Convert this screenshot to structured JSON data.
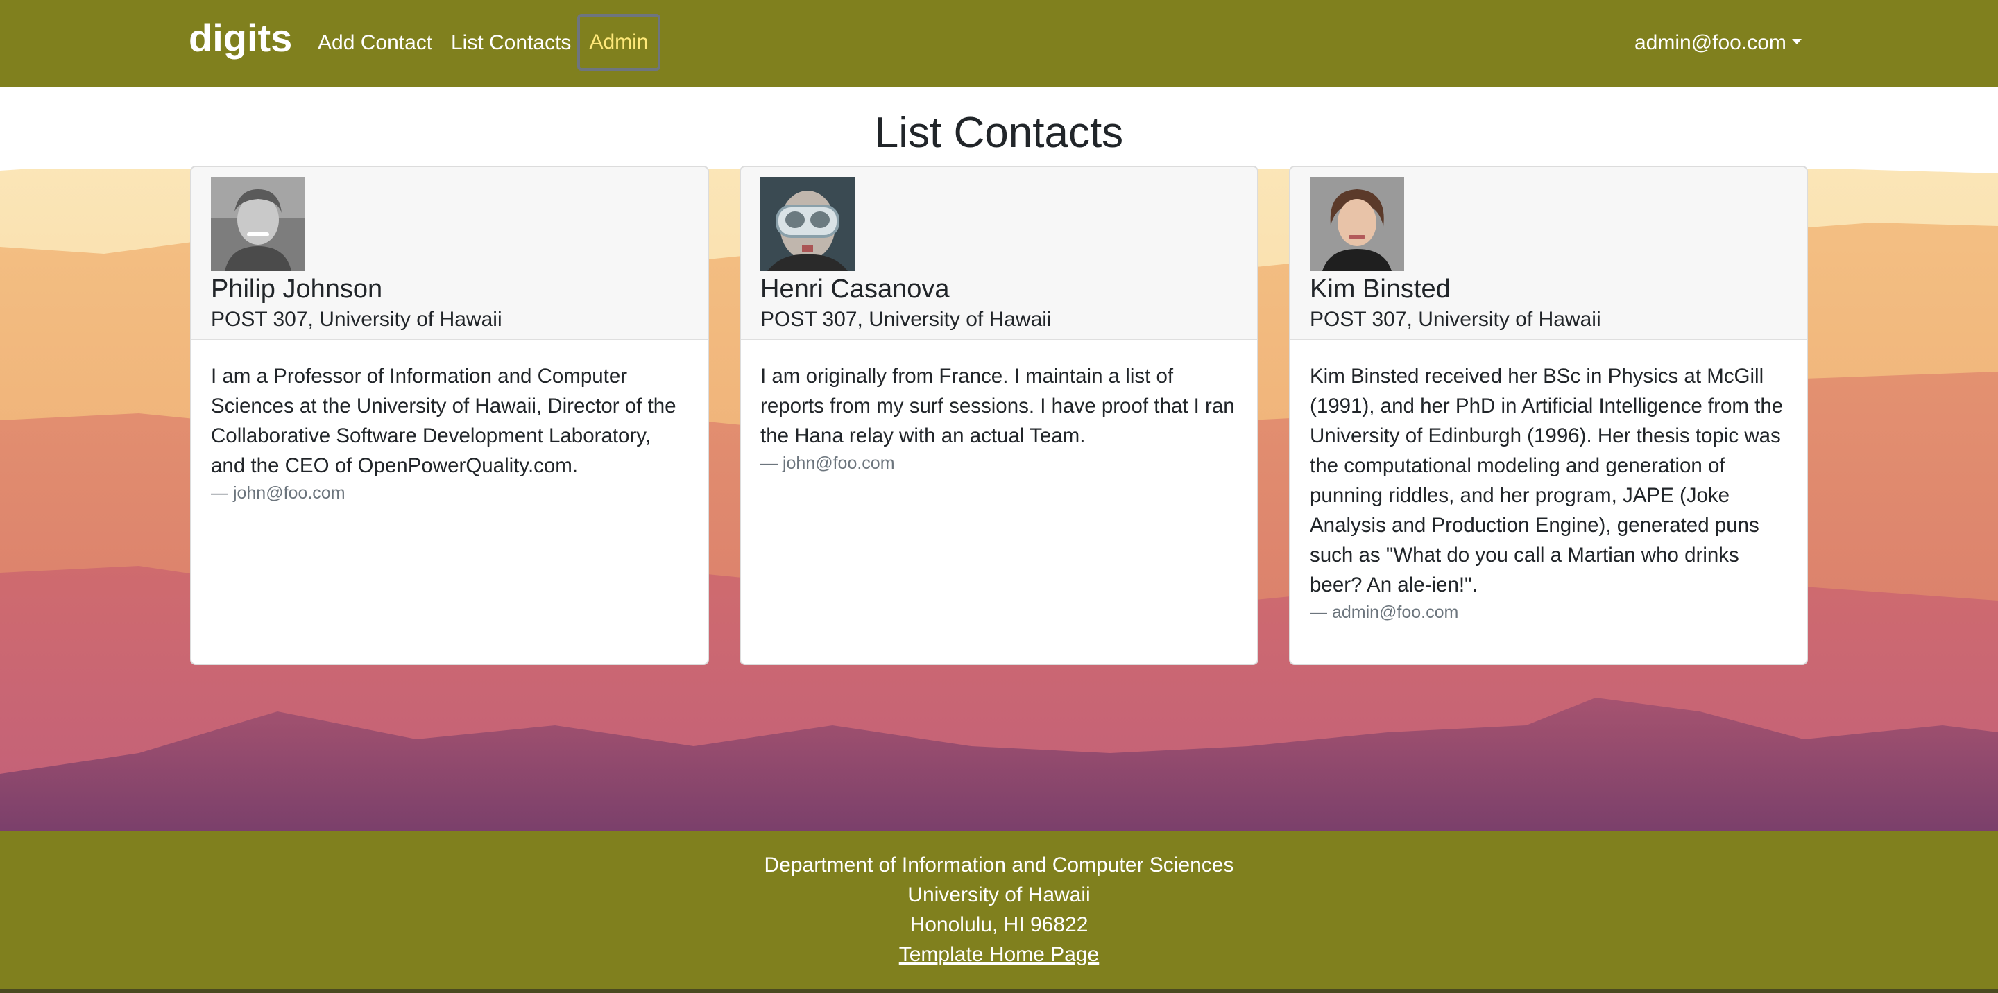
{
  "navbar": {
    "brand": "digits",
    "links": {
      "add_contact": "Add Contact",
      "list_contacts": "List Contacts",
      "admin": "Admin"
    },
    "user_menu": "admin@foo.com"
  },
  "page": {
    "title": "List Contacts"
  },
  "contacts": [
    {
      "name": "Philip Johnson",
      "address": "POST 307, University of Hawaii",
      "description": "I am a Professor of Information and Computer Sciences at the University of Hawaii, Director of the Collaborative Software Development Laboratory, and the CEO of OpenPowerQuality.com.",
      "owner": "— john@foo.com"
    },
    {
      "name": "Henri Casanova",
      "address": "POST 307, University of Hawaii",
      "description": "I am originally from France. I maintain a list of reports from my surf sessions. I have proof that I ran the Hana relay with an actual Team.",
      "owner": "— john@foo.com"
    },
    {
      "name": "Kim Binsted",
      "address": "POST 307, University of Hawaii",
      "description": "Kim Binsted received her BSc in Physics at McGill (1991), and her PhD in Artificial Intelligence from the University of Edinburgh (1996). Her thesis topic was the computational modeling and generation of punning riddles, and her program, JAPE (Joke Analysis and Production Engine), generated puns such as \"What do you call a Martian who drinks beer? An ale-ien!\".",
      "owner": "— admin@foo.com"
    }
  ],
  "footer": {
    "line1": "Department of Information and Computer Sciences",
    "line2": "University of Hawaii",
    "line3": "Honolulu, HI 96822",
    "link": "Template Home Page"
  },
  "colors": {
    "navbar": "#80801e",
    "active_link": "#ffe97a"
  }
}
